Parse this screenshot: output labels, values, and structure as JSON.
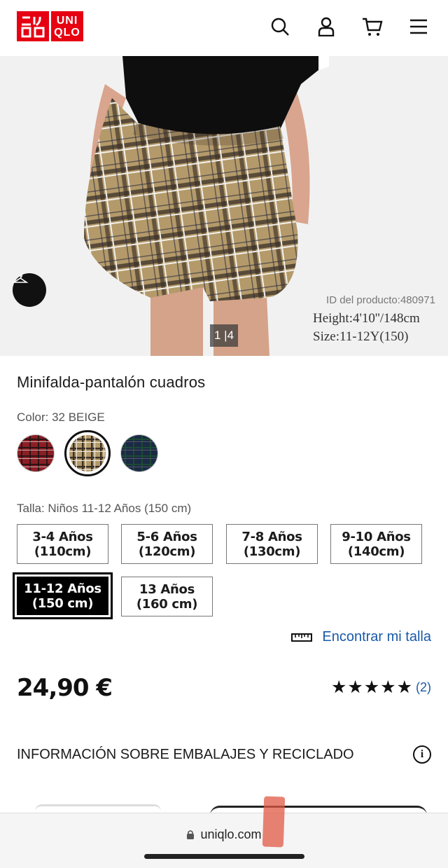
{
  "header": {
    "logo_top": "UNI",
    "logo_bottom": "QLO",
    "logo_katakana": "ユニクロ",
    "icons": [
      "search-icon",
      "account-icon",
      "cart-icon",
      "menu-icon"
    ]
  },
  "hero": {
    "product_id": "ID del producto:480971",
    "model_height": "Height:4'10''/148cm",
    "model_size": "Size:11-12Y(150)",
    "pager": "1 |4"
  },
  "product": {
    "title": "Minifalda-pantalón cuadros",
    "color_label": "Color: 32 BEIGE",
    "swatches": [
      {
        "name": "red",
        "color": "#8c1f25"
      },
      {
        "name": "beige",
        "color": "#b49a6a",
        "selected": true
      },
      {
        "name": "navy",
        "color": "#1b2a45"
      }
    ],
    "size_label": "Talla: Niños 11-12 Años (150 cm)",
    "sizes": [
      {
        "label": "3-4 Años\n(110cm)"
      },
      {
        "label": "5-6 Años\n(120cm)"
      },
      {
        "label": "7-8 Años\n(130cm)"
      },
      {
        "label": "9-10 Años\n(140cm)"
      },
      {
        "label": "11-12 Años\n(150 cm)",
        "selected": true
      },
      {
        "label": "13 Años\n(160 cm)"
      }
    ],
    "find_size": "Encontrar mi talla",
    "price": "24,90 €",
    "stars": "★★★★★",
    "rating_value": 5,
    "review_count": "(2)",
    "packaging": "INFORMACIÓN SOBRE EMBALAJES Y RECICLADO"
  },
  "browser": {
    "url": "uniqlo.com"
  },
  "colors": {
    "brand_red": "#e60012",
    "link_blue": "#1a5aa8"
  }
}
